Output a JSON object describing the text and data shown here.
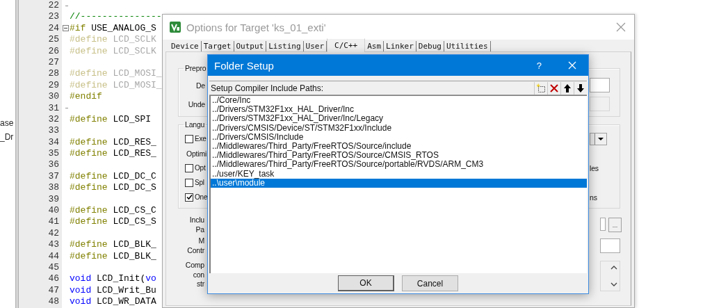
{
  "project_pane": {
    "items": [
      "ase",
      "_Dr"
    ]
  },
  "editor": {
    "lines": [
      {
        "number": "22",
        "fold_start": false,
        "fold_end": true
      },
      {
        "number": "23",
        "fold_start": false,
        "fold_end": false,
        "inactive": false,
        "segments": [
          {
            "kind": "comment",
            "text": "//---------------"
          }
        ]
      },
      {
        "number": "24",
        "fold_start": true,
        "fold_end": false,
        "inactive": false,
        "segments": [
          {
            "kind": "directive",
            "text": "#if"
          },
          {
            "kind": "plain",
            "text": " USE_ANALOG_S"
          }
        ]
      },
      {
        "number": "25",
        "fold_start": false,
        "fold_end": false,
        "inactive": true,
        "segments": [
          {
            "kind": "directive",
            "text": "#define"
          },
          {
            "kind": "plain",
            "text": " LCD_SCLK"
          }
        ]
      },
      {
        "number": "26",
        "fold_start": false,
        "fold_end": false,
        "inactive": true,
        "segments": [
          {
            "kind": "directive",
            "text": "#define"
          },
          {
            "kind": "plain",
            "text": " LCD_SCLK"
          }
        ]
      },
      {
        "number": "27",
        "fold_start": false,
        "fold_end": false
      },
      {
        "number": "28",
        "fold_start": false,
        "fold_end": false,
        "inactive": true,
        "segments": [
          {
            "kind": "directive",
            "text": "#define"
          },
          {
            "kind": "plain",
            "text": " LCD_MOSI_"
          }
        ]
      },
      {
        "number": "29",
        "fold_start": false,
        "fold_end": false,
        "inactive": true,
        "segments": [
          {
            "kind": "directive",
            "text": "#define"
          },
          {
            "kind": "plain",
            "text": " LCD_MOSI_"
          }
        ]
      },
      {
        "number": "30",
        "fold_start": false,
        "fold_end": false,
        "inactive": false,
        "segments": [
          {
            "kind": "directive",
            "text": "#endif"
          }
        ]
      },
      {
        "number": "31",
        "fold_start": false,
        "fold_end": true
      },
      {
        "number": "32",
        "fold_start": false,
        "fold_end": false,
        "inactive": false,
        "segments": [
          {
            "kind": "directive",
            "text": "#define"
          },
          {
            "kind": "plain",
            "text": " LCD_SPI"
          }
        ]
      },
      {
        "number": "33",
        "fold_start": false,
        "fold_end": false
      },
      {
        "number": "34",
        "fold_start": false,
        "fold_end": false,
        "inactive": false,
        "segments": [
          {
            "kind": "directive",
            "text": "#define"
          },
          {
            "kind": "plain",
            "text": " LCD_RES_"
          }
        ]
      },
      {
        "number": "35",
        "fold_start": false,
        "fold_end": false,
        "inactive": false,
        "segments": [
          {
            "kind": "directive",
            "text": "#define"
          },
          {
            "kind": "plain",
            "text": " LCD_RES_"
          }
        ]
      },
      {
        "number": "36",
        "fold_start": false,
        "fold_end": false
      },
      {
        "number": "37",
        "fold_start": false,
        "fold_end": false,
        "inactive": false,
        "segments": [
          {
            "kind": "directive",
            "text": "#define"
          },
          {
            "kind": "plain",
            "text": " LCD_DC_C"
          }
        ]
      },
      {
        "number": "38",
        "fold_start": false,
        "fold_end": false,
        "inactive": false,
        "segments": [
          {
            "kind": "directive",
            "text": "#define"
          },
          {
            "kind": "plain",
            "text": " LCD_DC_S"
          }
        ]
      },
      {
        "number": "39",
        "fold_start": false,
        "fold_end": false
      },
      {
        "number": "40",
        "fold_start": false,
        "fold_end": false,
        "inactive": false,
        "segments": [
          {
            "kind": "directive",
            "text": "#define"
          },
          {
            "kind": "plain",
            "text": " LCD_CS_C"
          }
        ]
      },
      {
        "number": "41",
        "fold_start": false,
        "fold_end": false,
        "inactive": false,
        "segments": [
          {
            "kind": "directive",
            "text": "#define"
          },
          {
            "kind": "plain",
            "text": " LCD_CS_S"
          }
        ]
      },
      {
        "number": "42",
        "fold_start": false,
        "fold_end": false
      },
      {
        "number": "43",
        "fold_start": false,
        "fold_end": false,
        "inactive": false,
        "segments": [
          {
            "kind": "directive",
            "text": "#define"
          },
          {
            "kind": "plain",
            "text": " LCD_BLK_"
          }
        ]
      },
      {
        "number": "44",
        "fold_start": false,
        "fold_end": false,
        "inactive": false,
        "segments": [
          {
            "kind": "directive",
            "text": "#define"
          },
          {
            "kind": "plain",
            "text": " LCD_BLK_"
          }
        ]
      },
      {
        "number": "45",
        "fold_start": false,
        "fold_end": false
      },
      {
        "number": "46",
        "fold_start": false,
        "fold_end": false,
        "inactive": false,
        "segments": [
          {
            "kind": "keyword",
            "text": "void"
          },
          {
            "kind": "plain",
            "text": " LCD_Init("
          },
          {
            "kind": "keyword",
            "text": "vo"
          }
        ]
      },
      {
        "number": "47",
        "fold_start": false,
        "fold_end": false,
        "inactive": false,
        "segments": [
          {
            "kind": "keyword",
            "text": "void"
          },
          {
            "kind": "plain",
            "text": " LCD_Writ_Bu"
          }
        ]
      },
      {
        "number": "48",
        "fold_start": false,
        "fold_end": false,
        "inactive": false,
        "segments": [
          {
            "kind": "keyword",
            "text": "void"
          },
          {
            "kind": "plain",
            "text": " LCD_WR_DATA"
          }
        ]
      }
    ]
  },
  "options_dialog": {
    "title": "Options for Target 'ks_01_exti'",
    "tabs": [
      {
        "label": "Device",
        "selected": false
      },
      {
        "label": "Target",
        "selected": false
      },
      {
        "label": "Output",
        "selected": false
      },
      {
        "label": "Listing",
        "selected": false
      },
      {
        "label": "User",
        "selected": false
      },
      {
        "label": "C/C++",
        "selected": true
      },
      {
        "label": "Asm",
        "selected": false
      },
      {
        "label": "Linker",
        "selected": false
      },
      {
        "label": "Debug",
        "selected": false
      },
      {
        "label": "Utilities",
        "selected": false
      }
    ],
    "preprocessor_group": {
      "legend": "Prepro",
      "rows": [
        {
          "label": "De",
          "disabled": false
        },
        {
          "label": "Unde",
          "disabled": true
        }
      ]
    },
    "language_group": {
      "legend": "Langu",
      "rows": [
        {
          "kind": "checkbox",
          "label": "Exe",
          "checked": false,
          "right": {
            "kind": "dropdown"
          }
        },
        {
          "kind": "label",
          "label": "Optimi"
        },
        {
          "kind": "checkbox",
          "label": "Opt",
          "checked": false,
          "right": {
            "kind": "text",
            "text": "les"
          }
        },
        {
          "kind": "checkbox",
          "label": "Spl",
          "checked": false
        },
        {
          "kind": "checkbox",
          "label": "One",
          "checked": true,
          "right": {
            "kind": "text",
            "text": "ns"
          }
        }
      ]
    },
    "lower_rows": [
      {
        "labels": [
          "Inclu",
          "Pa"
        ],
        "kind": "path",
        "browse_label": "..."
      },
      {
        "labels": [
          "M",
          "Contr"
        ],
        "kind": "field"
      },
      {
        "labels": [
          "Comp",
          "con",
          "str"
        ],
        "kind": "text_area"
      }
    ]
  },
  "folder_dialog": {
    "title": "Folder Setup",
    "help": "?",
    "header": "Setup Compiler Include Paths:",
    "paths": [
      {
        "text": "../Core/Inc",
        "selected": false
      },
      {
        "text": "../Drivers/STM32F1xx_HAL_Driver/Inc",
        "selected": false
      },
      {
        "text": "../Drivers/STM32F1xx_HAL_Driver/Inc/Legacy",
        "selected": false
      },
      {
        "text": "../Drivers/CMSIS/Device/ST/STM32F1xx/Include",
        "selected": false
      },
      {
        "text": "../Drivers/CMSIS/Include",
        "selected": false
      },
      {
        "text": "../Middlewares/Third_Party/FreeRTOS/Source/include",
        "selected": false
      },
      {
        "text": "../Middlewares/Third_Party/FreeRTOS/Source/CMSIS_RTOS",
        "selected": false
      },
      {
        "text": "../Middlewares/Third_Party/FreeRTOS/Source/portable/RVDS/ARM_CM3",
        "selected": false
      },
      {
        "text": "../user/KEY_task",
        "selected": false
      },
      {
        "text": "..\\user\\module",
        "selected": true
      }
    ],
    "buttons": [
      {
        "label": "OK",
        "default": true
      },
      {
        "label": "Cancel",
        "default": false
      }
    ]
  }
}
